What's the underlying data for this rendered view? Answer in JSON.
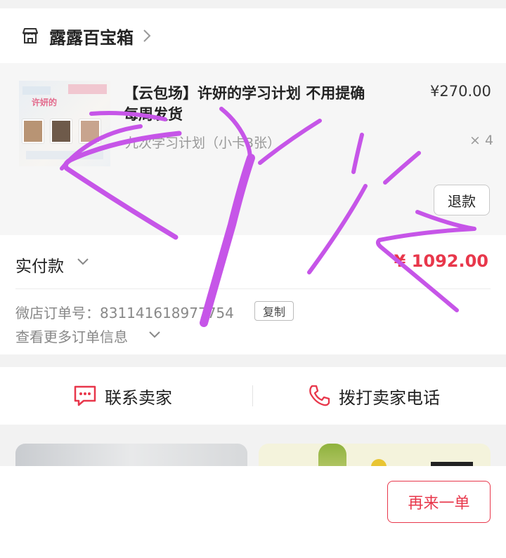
{
  "shop": {
    "name": "露露百宝箱",
    "icon": "store-icon",
    "chevron": "chevron-right-icon"
  },
  "product": {
    "title": "【云包场】许妍的学习计划 不用提确每周发货",
    "price": "¥270.00",
    "spec": "九次学习计划（小卡3张）",
    "quantity": "× 4",
    "refund_label": "退款"
  },
  "payment": {
    "label": "实付款",
    "amount": "¥ 1092.00",
    "order_label": "微店订单号：831141618977754",
    "copy_label": "复制",
    "more_info_label": "查看更多订单信息"
  },
  "contact": {
    "seller_label": "联系卖家",
    "call_label": "拨打卖家电话"
  },
  "footer": {
    "reorder_label": "再来一单"
  },
  "colors": {
    "accent": "#e8374b",
    "scribble": "#c655e8"
  }
}
